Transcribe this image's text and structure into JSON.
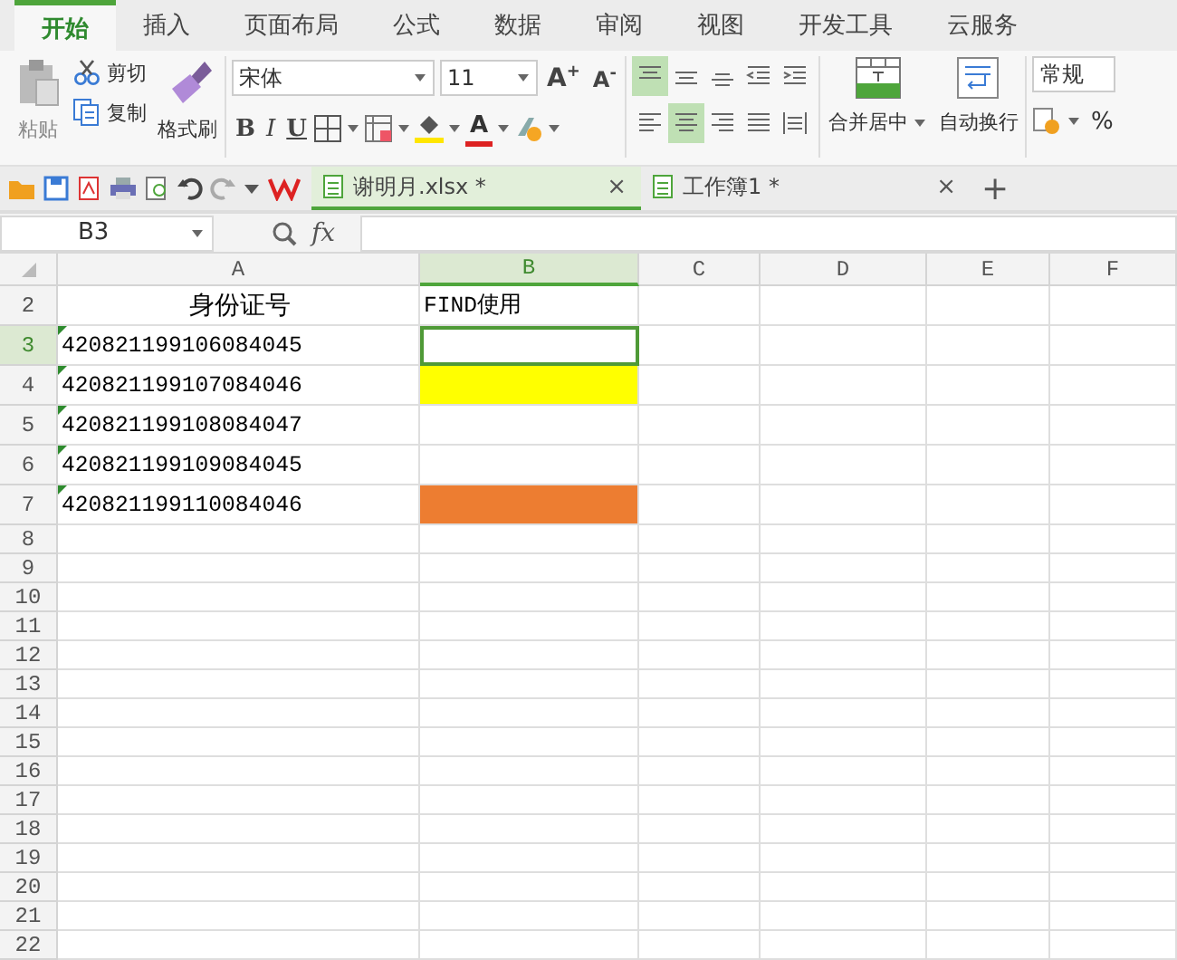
{
  "menu_tabs": [
    {
      "label": "开始",
      "selected": true
    },
    {
      "label": "插入",
      "selected": false
    },
    {
      "label": "页面布局",
      "selected": false
    },
    {
      "label": "公式",
      "selected": false
    },
    {
      "label": "数据",
      "selected": false
    },
    {
      "label": "审阅",
      "selected": false
    },
    {
      "label": "视图",
      "selected": false
    },
    {
      "label": "开发工具",
      "selected": false
    },
    {
      "label": "云服务",
      "selected": false
    }
  ],
  "ribbon": {
    "clipboard": {
      "paste": "粘贴",
      "cut": "剪切",
      "copy": "复制",
      "format_painter": "格式刷"
    },
    "font": {
      "name": "宋体",
      "size": "11",
      "grow": "A$^{+}$",
      "shrink": "A$^{-}$",
      "bold": "B",
      "italic": "I",
      "underline": "U",
      "font_color": "A"
    },
    "alignment": [
      {
        "kind": "top",
        "selected": true
      },
      {
        "kind": "middle",
        "selected": false
      },
      {
        "kind": "bottom",
        "selected": false
      },
      {
        "kind": "outdent",
        "selected": false
      },
      {
        "kind": "indent",
        "selected": false
      },
      {
        "kind": "left",
        "selected": false
      },
      {
        "kind": "center",
        "selected": true
      },
      {
        "kind": "right",
        "selected": false
      },
      {
        "kind": "justify",
        "selected": false
      },
      {
        "kind": "distributed",
        "selected": false
      }
    ],
    "merge_center": "合并居中",
    "wrap_text": "自动换行",
    "number_format": "常规",
    "percent": "%"
  },
  "doc_tabs": [
    {
      "label": "谢明月.xlsx *",
      "close": "×",
      "selected": true
    },
    {
      "label": "工作簿1 *",
      "close": "×",
      "selected": false
    }
  ],
  "new_tab": "+",
  "formula_bar": {
    "name_box": "B3",
    "fx": "fx"
  },
  "sheet": {
    "columns": [
      {
        "label": "A",
        "selected": false
      },
      {
        "label": "B",
        "selected": true
      },
      {
        "label": "C",
        "selected": false
      },
      {
        "label": "D",
        "selected": false
      },
      {
        "label": "E",
        "selected": false
      },
      {
        "label": "F",
        "selected": false
      }
    ],
    "rows": [
      {
        "number": "2",
        "selected": false,
        "cells": [
          {
            "text": "身份证号",
            "kind": "heading",
            "warning": false,
            "selected": false
          },
          {
            "text": "FIND使用",
            "kind": "text",
            "warning": false,
            "selected": false
          }
        ]
      },
      {
        "number": "3",
        "selected": true,
        "cells": [
          {
            "text": "420821199106084045",
            "kind": "text",
            "warning": true,
            "selected": false
          },
          {
            "kind": "text",
            "warning": false,
            "selected": true
          }
        ]
      },
      {
        "number": "4",
        "selected": false,
        "cells": [
          {
            "text": "420821199107084046",
            "kind": "text",
            "warning": true,
            "selected": false
          },
          {
            "kind": "text",
            "warning": false,
            "selected": false,
            "color": "#ffff00"
          }
        ]
      },
      {
        "number": "5",
        "selected": false,
        "cells": [
          {
            "text": "420821199108084047",
            "kind": "text",
            "warning": true,
            "selected": false
          },
          {
            "kind": "text",
            "warning": false,
            "selected": false
          }
        ]
      },
      {
        "number": "6",
        "selected": false,
        "cells": [
          {
            "text": "420821199109084045",
            "kind": "text",
            "warning": true,
            "selected": false
          },
          {
            "kind": "text",
            "warning": false,
            "selected": false
          }
        ]
      },
      {
        "number": "7",
        "selected": false,
        "cells": [
          {
            "text": "420821199110084046",
            "kind": "text",
            "warning": true,
            "selected": false
          },
          {
            "kind": "text",
            "warning": false,
            "selected": false,
            "color": "#ed7d31"
          }
        ]
      },
      {
        "number": "8",
        "selected": false
      },
      {
        "number": "9",
        "selected": false
      },
      {
        "number": "10",
        "selected": false
      },
      {
        "number": "11",
        "selected": false
      },
      {
        "number": "12",
        "selected": false
      },
      {
        "number": "13",
        "selected": false
      },
      {
        "number": "14",
        "selected": false
      },
      {
        "number": "15",
        "selected": false
      },
      {
        "number": "16",
        "selected": false
      },
      {
        "number": "17",
        "selected": false
      },
      {
        "number": "18",
        "selected": false
      },
      {
        "number": "19",
        "selected": false
      },
      {
        "number": "20",
        "selected": false
      },
      {
        "number": "21",
        "selected": false
      },
      {
        "number": "22",
        "selected": false
      }
    ]
  }
}
